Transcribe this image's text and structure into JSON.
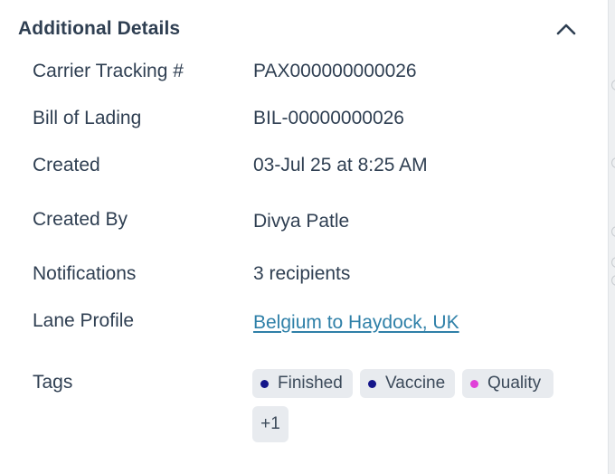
{
  "section": {
    "title": "Additional Details"
  },
  "details": {
    "carrier_tracking": {
      "label": "Carrier Tracking #",
      "value": "PAX000000000026"
    },
    "bill_of_lading": {
      "label": "Bill of Lading",
      "value": "BIL-00000000026"
    },
    "created": {
      "label": "Created",
      "value": "03-Jul 25 at 8:25 AM"
    },
    "created_by": {
      "label": "Created By",
      "value": "Divya Patle"
    },
    "notifications": {
      "label": "Notifications",
      "value": "3 recipients"
    },
    "lane_profile": {
      "label": "Lane Profile",
      "value": "Belgium to Haydock, UK"
    },
    "tags": {
      "label": "Tags"
    }
  },
  "tags": [
    {
      "label": "Finished",
      "color": "#15168a"
    },
    {
      "label": "Vaccine",
      "color": "#15168a"
    },
    {
      "label": "Quality",
      "color": "#e040d8"
    }
  ],
  "tags_more": "+1",
  "icons": {
    "collapse": "chevron-up-icon"
  }
}
